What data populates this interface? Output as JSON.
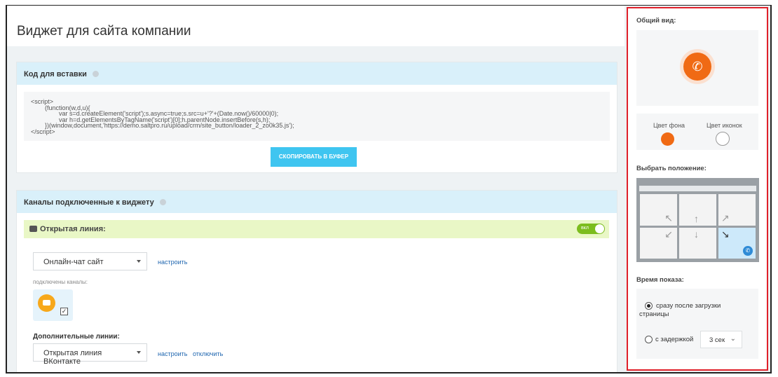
{
  "page": {
    "title": "Виджет для сайта компании"
  },
  "embed": {
    "header": "Код для вставки",
    "code": "<script>\n        (function(w,d,u){\n                var s=d.createElement('script');s.async=true;s.src=u+'?'+(Date.now()/60000|0);\n                var h=d.getElementsByTagName('script')[0];h.parentNode.insertBefore(s,h);\n        })(window,document,'https://demo.saltpro.ru/upload/crm/site_button/loader_2_zo0k35.js');\n</script>",
    "copy_label": "СКОПИРОВАТЬ В БУФЕР"
  },
  "channels": {
    "header": "Каналы подключенные к виджету",
    "open_line": {
      "label": "Открытая линия:",
      "toggle_label": "вкл",
      "toggle_on": true,
      "select_value": "Онлайн-чат сайт",
      "configure": "настроить",
      "connected_label": "подключены каналы:",
      "channel_checked": true
    },
    "extra": {
      "label": "Дополнительные линии:",
      "select_value": "Открытая линия ВКонтакте",
      "configure": "настроить",
      "disable": "отключить"
    }
  },
  "side": {
    "overview_label": "Общий вид:",
    "bg_color_label": "Цвет фона",
    "icon_color_label": "Цвет иконок",
    "bg_color": "#f06a14",
    "icon_color": "#ffffff",
    "position_label": "Выбрать положение:",
    "selected_position": "bottom-right",
    "show_time_label": "Время показа:",
    "opt_immediate": "сразу после загрузки страницы",
    "opt_delay": "с задержкой",
    "selected_option": "immediate",
    "delay_value": "3 сек"
  }
}
